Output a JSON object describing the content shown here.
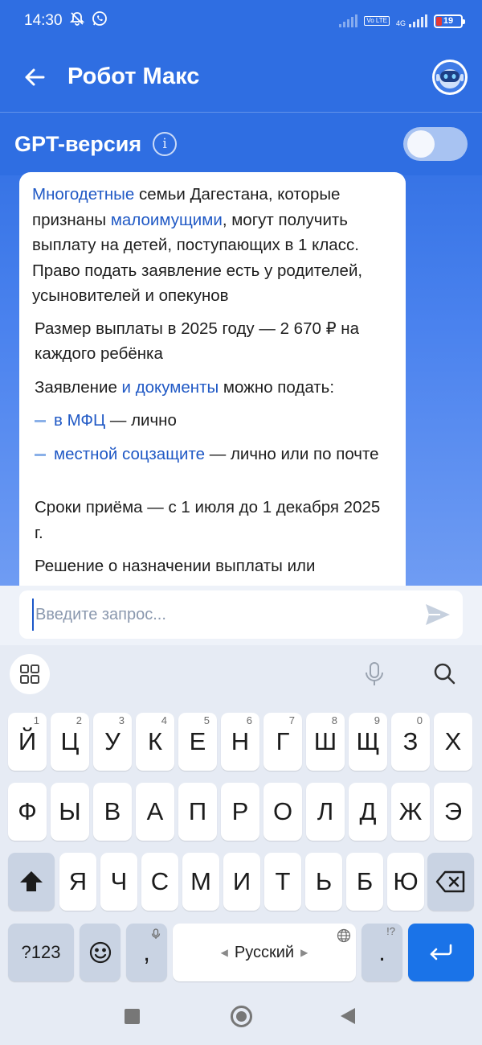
{
  "status_bar": {
    "time": "14:30",
    "icons": [
      "mute-bell-icon",
      "whatsapp-icon",
      "signal-icon",
      "volte-icon",
      "4g-signal-icon",
      "battery-icon"
    ],
    "volte_label": "Vo LTE",
    "network": "4G",
    "battery_level": "19",
    "battery_color": "#e53935"
  },
  "app_bar": {
    "title": "Робот Макс",
    "back_icon": "arrow-left-icon",
    "avatar_icon": "robot-avatar-icon",
    "background": "#2f6ee2"
  },
  "gpt_toggle": {
    "label": "GPT-версия",
    "info_icon": "i",
    "enabled": false
  },
  "message": {
    "p1_link1": "Многодетные",
    "p1_text1": " семьи Дагестана, которые признаны ",
    "p1_link2": "малоимущими",
    "p1_text2": ", могут получить выплату на детей, поступающих в 1 класс. Право подать заявление есть у родителей, усыновителей и опекунов",
    "p2": "Размер выплаты в 2025 году — 2 670 ₽ на каждого ребёнка",
    "p3_text1": "Заявление ",
    "p3_link": "и документы",
    "p3_text2": " можно подать:",
    "bullets": [
      {
        "link": "в МФЦ",
        "text": " — лично"
      },
      {
        "link": "местной соцзащите",
        "text": " — лично или по почте"
      }
    ],
    "p4": "Сроки приёма — с 1 июля до 1 декабря 2025 г.",
    "p5": "Решение о назначении выплаты или",
    "link_color": "#2059c5"
  },
  "input": {
    "placeholder": "Введите запрос...",
    "value": "",
    "send_icon": "send-icon"
  },
  "keyboard": {
    "tools": [
      "grid-icon",
      "mic-icon",
      "search-icon"
    ],
    "row1": [
      {
        "k": "Й",
        "h": "1"
      },
      {
        "k": "Ц",
        "h": "2"
      },
      {
        "k": "У",
        "h": "3"
      },
      {
        "k": "К",
        "h": "4"
      },
      {
        "k": "Е",
        "h": "5"
      },
      {
        "k": "Н",
        "h": "6"
      },
      {
        "k": "Г",
        "h": "7"
      },
      {
        "k": "Ш",
        "h": "8"
      },
      {
        "k": "Щ",
        "h": "9"
      },
      {
        "k": "З",
        "h": "0"
      },
      {
        "k": "Х",
        "h": ""
      }
    ],
    "row2": [
      "Ф",
      "Ы",
      "В",
      "А",
      "П",
      "Р",
      "О",
      "Л",
      "Д",
      "Ж",
      "Э"
    ],
    "row3": [
      "Я",
      "Ч",
      "С",
      "М",
      "И",
      "Т",
      "Ь",
      "Б",
      "Ю"
    ],
    "shift_icon": "shift-icon",
    "backspace_icon": "backspace-icon",
    "numbers_label": "?123",
    "emoji_icon": "emoji-icon",
    "comma": ",",
    "space_label": "Русский",
    "period": ".",
    "period_hint": "!?",
    "enter_icon": "enter-icon",
    "enter_color": "#1a73e8"
  },
  "nav_bar": {
    "icons": [
      "recents-square-icon",
      "home-circle-icon",
      "back-triangle-icon"
    ]
  }
}
